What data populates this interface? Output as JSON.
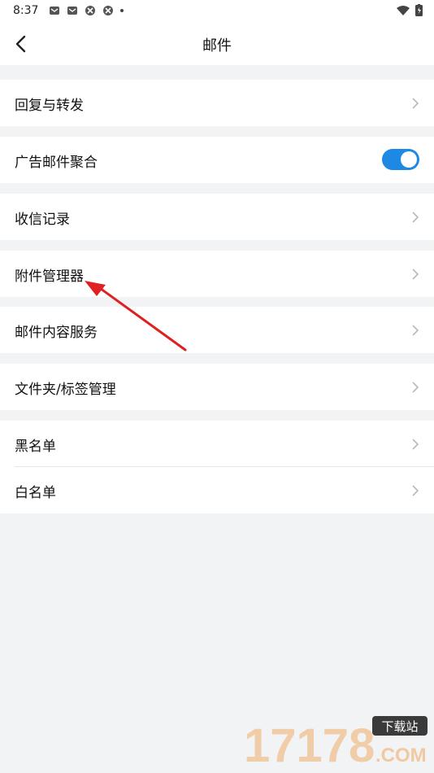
{
  "status_bar": {
    "time": "8:37"
  },
  "header": {
    "title": "邮件"
  },
  "rows": {
    "reply_forward": "回复与转发",
    "ad_mail_aggregate": "广告邮件聚合",
    "receive_record": "收信记录",
    "attachment_manager": "附件管理器",
    "mail_content_service": "邮件内容服务",
    "folder_tag_manage": "文件夹/标签管理",
    "blacklist": "黑名单",
    "whitelist": "白名单"
  },
  "toggle": {
    "ad_mail_aggregate_on": true
  },
  "colors": {
    "accent": "#1e88e5",
    "arrow": "#e02020",
    "background": "#f2f3f5"
  },
  "watermark": {
    "text": "17178",
    "badge": "下载站",
    "suffix": ".COM"
  }
}
